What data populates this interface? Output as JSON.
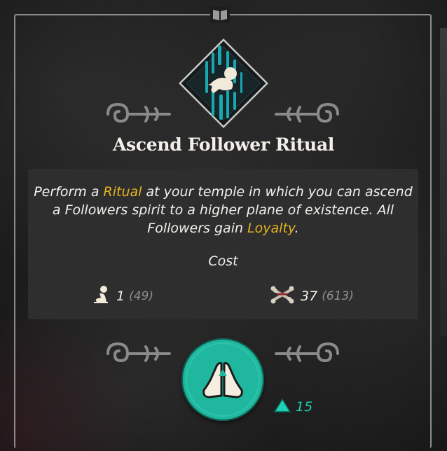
{
  "ritual": {
    "title": "Ascend Follower Ritual",
    "description": {
      "part1": "Perform a ",
      "keyword1": "Ritual",
      "part2": " at your temple in which you can ascend a Followers spirit to a higher plane of existence. All Followers gain ",
      "keyword2": "Loyalty",
      "part3": "."
    },
    "cost_label": "Cost",
    "costs": [
      {
        "icon": "follower-icon",
        "amount": "1",
        "total": "(49)"
      },
      {
        "icon": "bones-icon",
        "amount": "37",
        "total": "(613)"
      }
    ],
    "action_icon": "praying-hands-icon",
    "devotion": {
      "icon": "devotion-triangle-icon",
      "value": "15"
    }
  },
  "colors": {
    "keyword": "#e6b320",
    "accent": "#1fb89e",
    "devotion": "#1ed1b2",
    "icon_bg": "#183036",
    "icon_lines": "#1aa8b0"
  }
}
